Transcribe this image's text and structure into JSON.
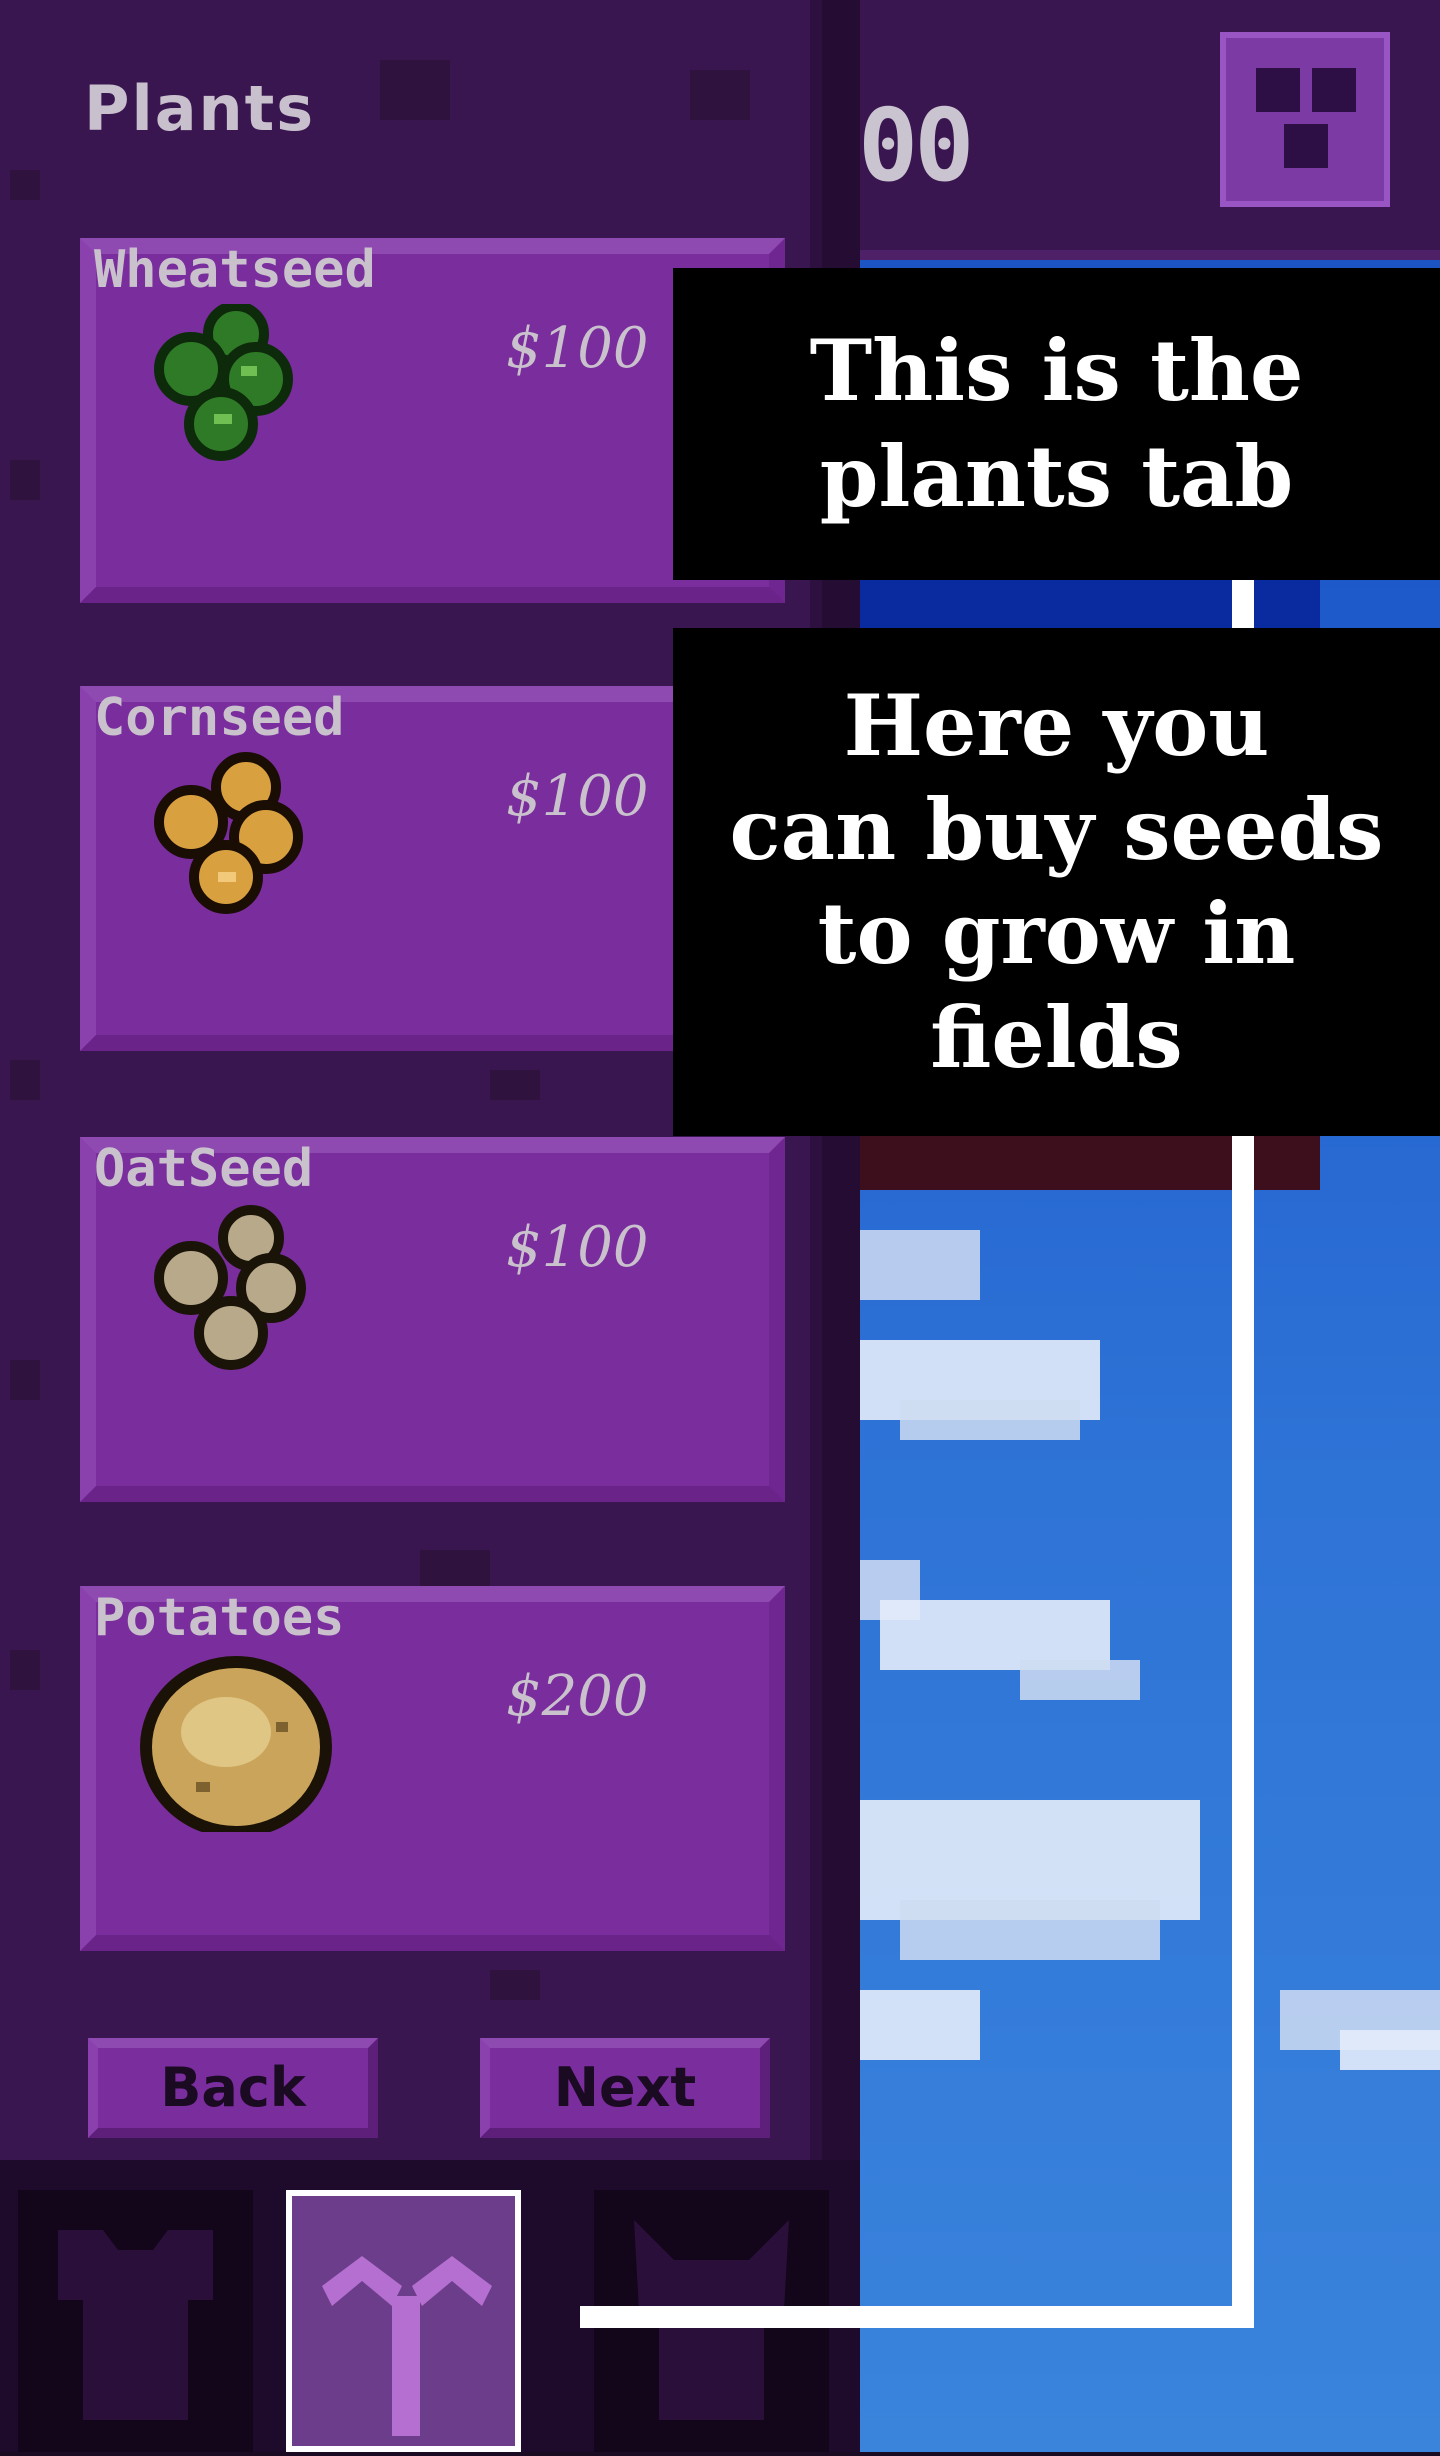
{
  "header": {
    "money_partial": "00",
    "menu_icon": "grid-menu-icon"
  },
  "panel": {
    "title": "Plants",
    "items": [
      {
        "name": "Wheatseed",
        "price": "$100",
        "icon": "wheat-seed-icon",
        "color": "#2f7a26"
      },
      {
        "name": "Cornseed",
        "price": "$100",
        "icon": "corn-seed-icon",
        "color": "#d9a040"
      },
      {
        "name": "OatSeed",
        "price": "$100",
        "icon": "oat-seed-icon",
        "color": "#b8a98a"
      },
      {
        "name": "Potatoes",
        "price": "$200",
        "icon": "potato-icon",
        "color": "#c9a45a"
      }
    ],
    "back_label": "Back",
    "next_label": "Next"
  },
  "tabs": [
    {
      "icon": "shirt-icon",
      "active": false
    },
    {
      "icon": "sprout-icon",
      "active": true
    },
    {
      "icon": "animal-icon",
      "active": false
    }
  ],
  "tutorial": {
    "tip1": "This is the\nplants tab",
    "tip2": "Here you\ncan buy seeds\nto grow in\nfields"
  },
  "colors": {
    "panel": "#3a1650",
    "card": "#7a2d9d",
    "sky": "#1f5ccc"
  }
}
